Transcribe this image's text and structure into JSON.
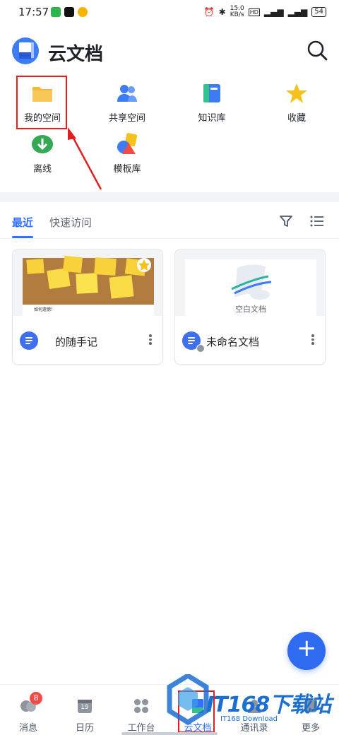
{
  "status_bar": {
    "time": "17:57",
    "speed": "15.0",
    "speed_unit": "KB/s",
    "battery": "54"
  },
  "header": {
    "title": "云文档",
    "search_icon": "search-icon"
  },
  "grid": {
    "items": [
      {
        "label": "我的空间",
        "icon": "folder-icon",
        "color": "#f5b83d"
      },
      {
        "label": "共享空间",
        "icon": "people-icon",
        "color": "#3d7cf5"
      },
      {
        "label": "知识库",
        "icon": "knowledge-icon",
        "color": "#3d7cf5"
      },
      {
        "label": "收藏",
        "icon": "star-icon",
        "color": "#f5c21b"
      },
      {
        "label": "离线",
        "icon": "download-icon",
        "color": "#34a853"
      },
      {
        "label": "模板库",
        "icon": "template-icon",
        "color": "#f5b83d"
      }
    ]
  },
  "tabs": {
    "recent": "最近",
    "quick": "快速访问"
  },
  "cards": [
    {
      "title": "的随手记",
      "thumb_caption": "如何遗憾！"
    },
    {
      "title": "未命名文档",
      "thumb_caption": "空白文档"
    }
  ],
  "fab": {
    "label": "+"
  },
  "bottom_nav": {
    "items": [
      {
        "label": "消息",
        "badge": "8"
      },
      {
        "label": "日历",
        "date": "19"
      },
      {
        "label": "工作台"
      },
      {
        "label": "云文档"
      },
      {
        "label": "通讯录"
      },
      {
        "label": "更多"
      }
    ]
  },
  "watermark": {
    "text": "IT168下载站",
    "sub": "IT168 Download"
  },
  "colors": {
    "accent": "#3370ff",
    "annotation": "#e02020"
  }
}
